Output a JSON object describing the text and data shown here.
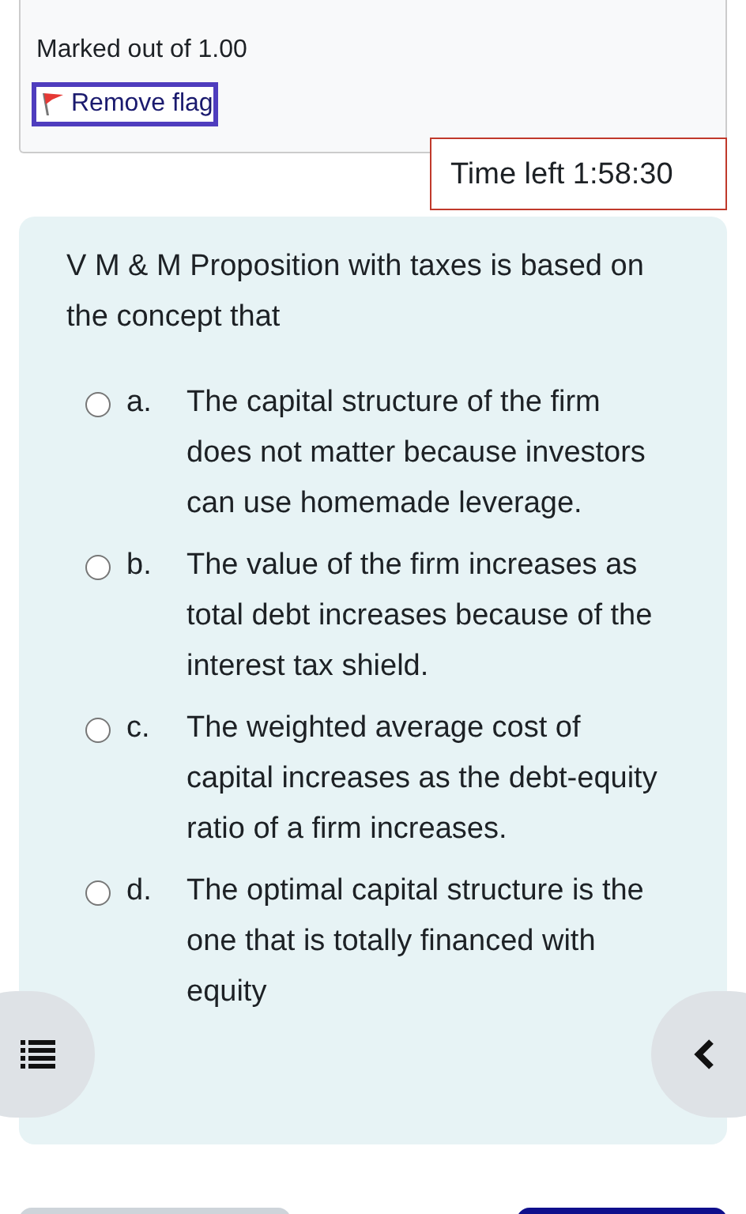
{
  "info": {
    "marks": "Marked out of 1.00",
    "flag_button": {
      "label": "Remove flag",
      "flagged": true
    }
  },
  "timer": "Time left 1:58:30",
  "question": {
    "text": "V M & M Proposition with taxes is based on the concept that",
    "options": [
      {
        "letter": "a.",
        "text": "The capital structure of the firm does not matter because investors can use homemade leverage.",
        "selected": false
      },
      {
        "letter": "b.",
        "text": "The value of the firm increases as total debt increases because of the interest tax shield.",
        "selected": false
      },
      {
        "letter": "c.",
        "text": "The weighted average cost of capital increases as the debt-equity ratio of a firm increases.",
        "selected": false
      },
      {
        "letter": "d.",
        "text": "The optimal capital structure is the one that is totally financed with equity",
        "selected": false
      }
    ]
  }
}
